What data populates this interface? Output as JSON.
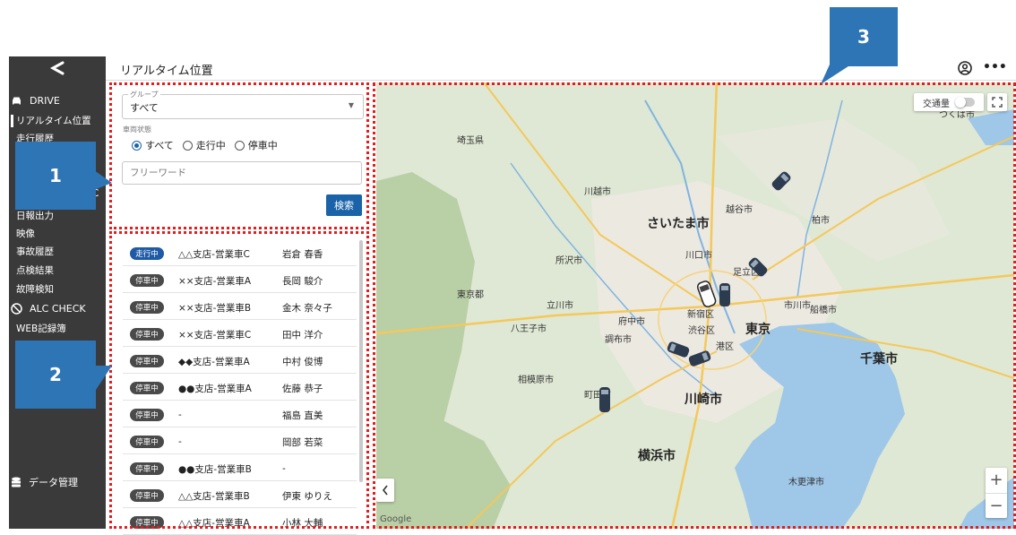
{
  "app": {
    "back_icon": "chevron-left-icon",
    "page_title": "リアルタイム位置"
  },
  "header": {
    "account_icon": "account-circle-icon",
    "more_icon": "more-horizontal-icon"
  },
  "sidebar": {
    "drive_section": {
      "label": "DRIVE",
      "icon": "car-icon"
    },
    "items": [
      {
        "label": "リアルタイム位置",
        "active": true
      },
      {
        "label": "走行履歴"
      },
      {
        "label": "C"
      },
      {
        "label": "日報出力"
      },
      {
        "label": "映像"
      },
      {
        "label": "事故履歴"
      },
      {
        "label": "点検結果"
      },
      {
        "label": "故障検知"
      }
    ],
    "alc_section": {
      "label": "ALC CHECK",
      "icon": "no-alcohol-icon"
    },
    "alc_items": [
      {
        "label": "WEB記録簿"
      }
    ],
    "data_section": {
      "label": "データ管理",
      "icon": "database-icon"
    }
  },
  "filter": {
    "group_label": "グループ",
    "group_value": "すべて",
    "status_label": "車両状態",
    "status_options": [
      {
        "label": "すべて",
        "selected": true
      },
      {
        "label": "走行中",
        "selected": false
      },
      {
        "label": "停車中",
        "selected": false
      }
    ],
    "keyword_placeholder": "フリーワード",
    "search_label": "検索"
  },
  "vehicles": [
    {
      "status": "走行中",
      "name": "△△支店-営業車C",
      "driver": "岩倉 春香"
    },
    {
      "status": "停車中",
      "name": "××支店-営業車A",
      "driver": "長岡 駿介"
    },
    {
      "status": "停車中",
      "name": "××支店-営業車B",
      "driver": "金木 奈々子"
    },
    {
      "status": "停車中",
      "name": "××支店-営業車C",
      "driver": "田中 洋介"
    },
    {
      "status": "停車中",
      "name": "◆◆支店-営業車A",
      "driver": "中村 俊博"
    },
    {
      "status": "停車中",
      "name": "●●支店-営業車A",
      "driver": "佐藤 恭子"
    },
    {
      "status": "停車中",
      "name": "-",
      "driver": "福島 直美"
    },
    {
      "status": "停車中",
      "name": "-",
      "driver": "岡部 若菜"
    },
    {
      "status": "停車中",
      "name": "●●支店-営業車B",
      "driver": "-"
    },
    {
      "status": "停車中",
      "name": "△△支店-営業車B",
      "driver": "伊東 ゆりえ"
    },
    {
      "status": "停車中",
      "name": "△△支店-営業車A",
      "driver": "小林 大輔"
    }
  ],
  "map": {
    "traffic_label": "交通量",
    "fullscreen_icon": "fullscreen-icon",
    "zoom_in": "+",
    "zoom_out": "−",
    "collapse_icon": "chevron-left-icon",
    "attribution": "Google",
    "cities_big": [
      "さいたま市",
      "東京",
      "横浜市",
      "川崎市",
      "千葉市"
    ],
    "cities": [
      "川越市",
      "越谷市",
      "川口市",
      "足立区",
      "新宿区",
      "渋谷区",
      "港区",
      "八王子市",
      "相模原市",
      "町田市",
      "船橋市",
      "柏市",
      "つくば市",
      "東京都",
      "埼玉県",
      "所沢市",
      "立川市",
      "府中市",
      "調布市",
      "市川市",
      "木更津市"
    ]
  },
  "callouts": [
    "1",
    "2",
    "3"
  ],
  "colors": {
    "sidebar_bg": "#3a3a3a",
    "accent_blue": "#1a63a8",
    "running_badge": "#1f5aa6",
    "stopped_badge": "#4a4a4a",
    "highlight_red": "#e51c1c",
    "callout_blue": "#2e75b6"
  }
}
